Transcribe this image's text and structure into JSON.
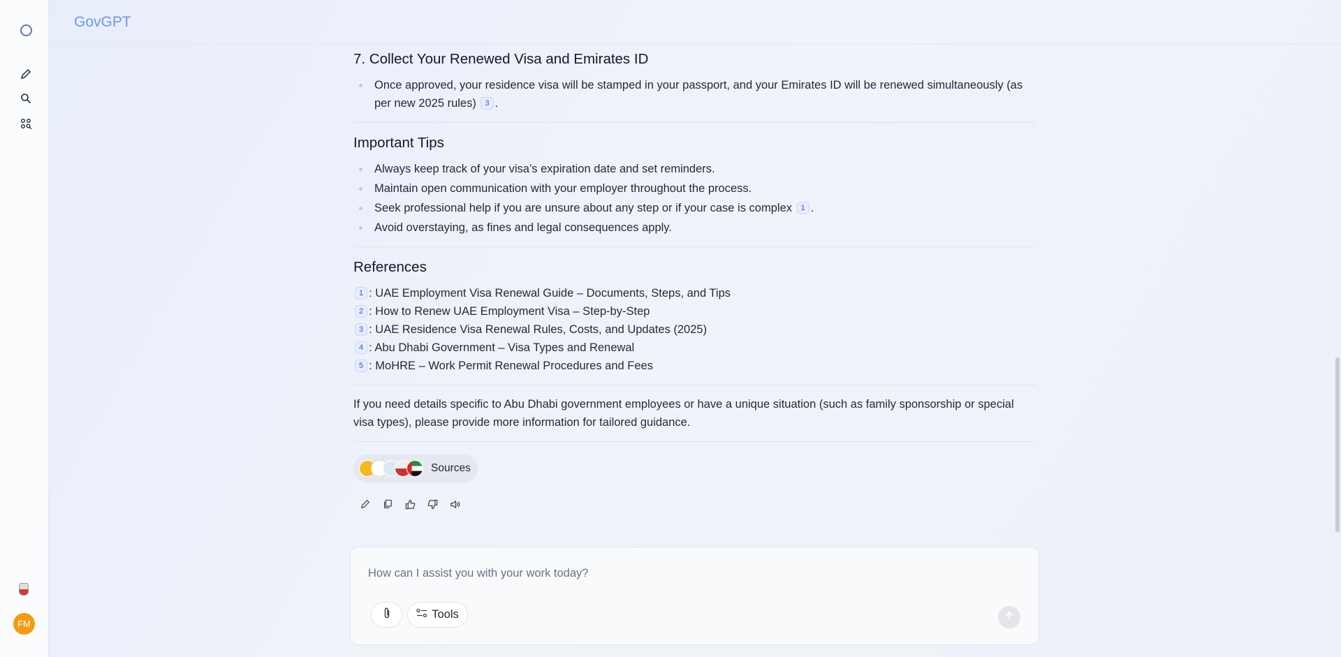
{
  "header": {
    "title": "GovGPT"
  },
  "user": {
    "initials": "FM"
  },
  "section7": {
    "title": "7. Collect Your Renewed Visa and Emirates ID",
    "bullet": "Once approved, your residence visa will be stamped in your passport, and your Emirates ID will be renewed simultaneously (as per new 2025 rules)",
    "cite": "3"
  },
  "tips": {
    "title": "Important Tips",
    "items": [
      "Always keep track of your visa’s expiration date and set reminders.",
      "Maintain open communication with your employer throughout the process.",
      "Seek professional help if you are unsure about any step or if your case is complex",
      "Avoid overstaying, as fines and legal consequences apply."
    ],
    "cite": "1"
  },
  "references": {
    "title": "References",
    "items": [
      {
        "n": "1",
        "text": ": UAE Employment Visa Renewal Guide – Documents, Steps, and Tips"
      },
      {
        "n": "2",
        "text": ": How to Renew UAE Employment Visa – Step-by-Step"
      },
      {
        "n": "3",
        "text": ": UAE Residence Visa Renewal Rules, Costs, and Updates (2025)"
      },
      {
        "n": "4",
        "text": ": Abu Dhabi Government – Visa Types and Renewal"
      },
      {
        "n": "5",
        "text": ": MoHRE – Work Permit Renewal Procedures and Fees"
      }
    ]
  },
  "closing": "If you need details specific to Abu Dhabi government employees or have a unique situation (such as family sponsorship or special visa types), please provide more information for tailored guidance.",
  "sources": {
    "label": "Sources"
  },
  "composer": {
    "placeholder": "How can I assist you with your work today?",
    "tools_label": "Tools"
  }
}
